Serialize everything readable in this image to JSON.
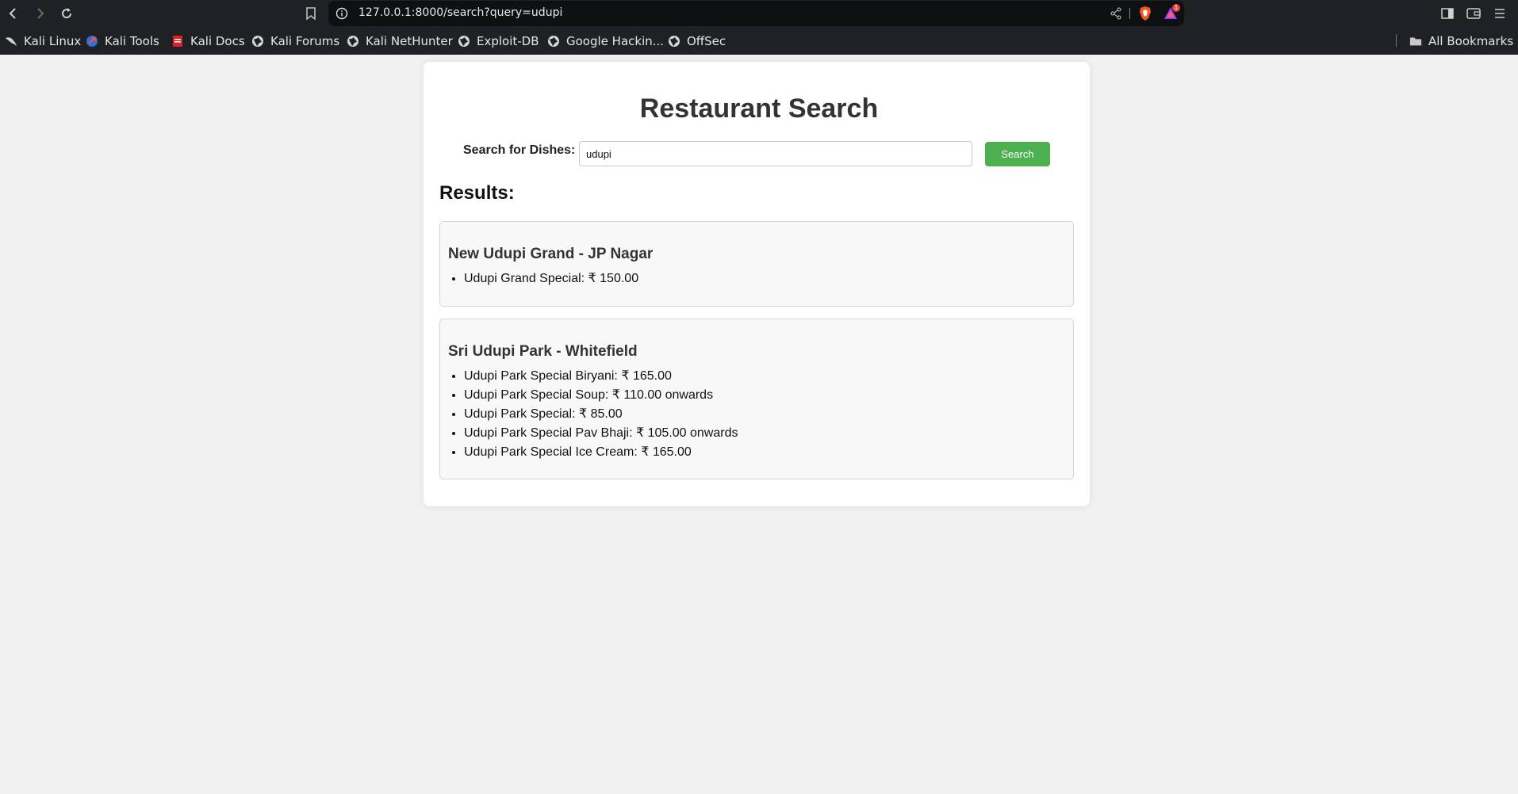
{
  "browser": {
    "url": "127.0.0.1:8000/search?query=udupi",
    "rewards_badge": "1",
    "bookmarks": [
      {
        "label": "Kali Linux",
        "icon": "kali-dragon-icon"
      },
      {
        "label": "Kali Tools",
        "icon": "kali-tools-icon"
      },
      {
        "label": "Kali Docs",
        "icon": "kali-docs-icon"
      },
      {
        "label": "Kali Forums",
        "icon": "globe-icon"
      },
      {
        "label": "Kali NetHunter",
        "icon": "globe-icon"
      },
      {
        "label": "Exploit-DB",
        "icon": "globe-icon"
      },
      {
        "label": "Google Hackin...",
        "icon": "globe-icon"
      },
      {
        "label": "OffSec",
        "icon": "globe-icon"
      }
    ],
    "all_bookmarks": "All Bookmarks"
  },
  "page": {
    "title": "Restaurant Search",
    "search_label": "Search for Dishes:",
    "search_value": "udupi",
    "search_button": "Search",
    "results_heading": "Results:"
  },
  "results": [
    {
      "name": "New Udupi Grand - JP Nagar",
      "dishes": [
        "Udupi Grand Special: ₹ 150.00"
      ]
    },
    {
      "name": "Sri Udupi Park - Whitefield",
      "dishes": [
        "Udupi Park Special Biryani: ₹ 165.00",
        "Udupi Park Special Soup: ₹ 110.00 onwards",
        "Udupi Park Special: ₹ 85.00",
        "Udupi Park Special Pav Bhaji: ₹ 105.00 onwards",
        "Udupi Park Special Ice Cream: ₹ 165.00"
      ]
    }
  ],
  "colors": {
    "chrome_bg": "#202124",
    "page_bg": "#f1f1f1",
    "button_bg": "#4caf50"
  }
}
